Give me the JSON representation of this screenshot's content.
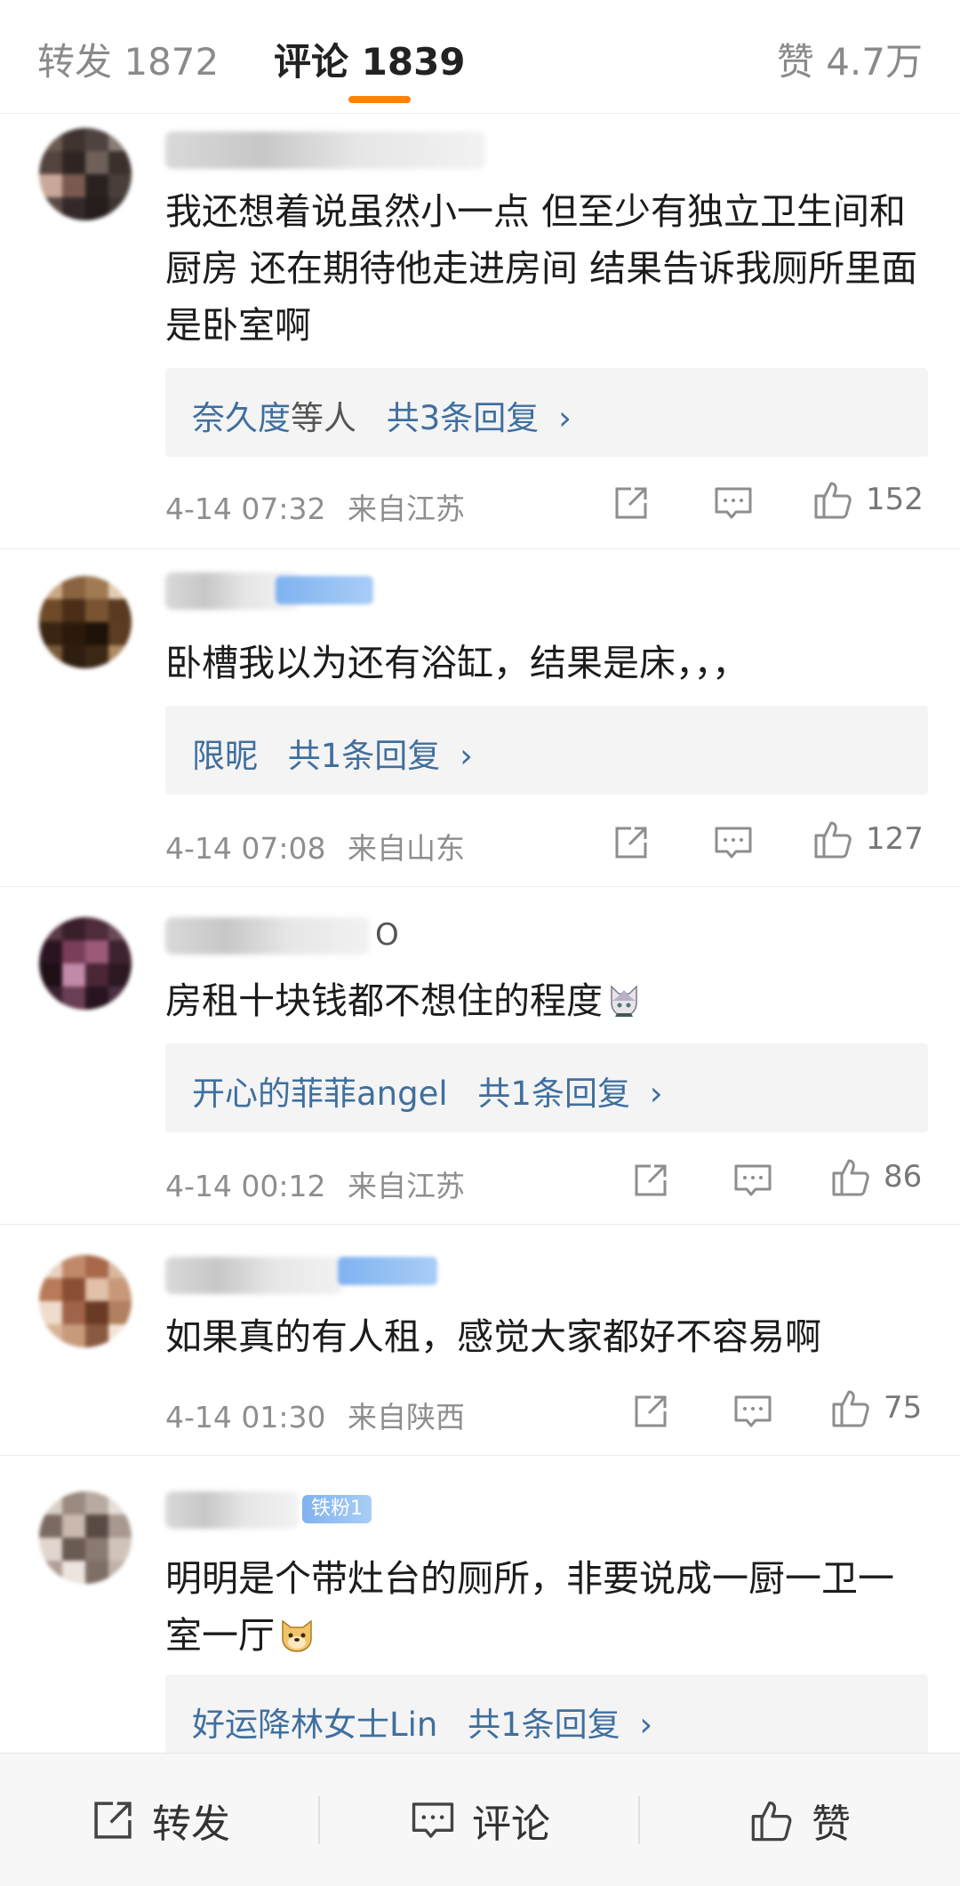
{
  "tabs": {
    "repost": "转发 1872",
    "comments": "评论 1839",
    "likes": "赞 4.7万"
  },
  "comments": [
    {
      "text": "我还想着说虽然小一点 但至少有独立卫生间和厨房 还在期待他走进房间 结果告诉我厕所里面是卧室啊",
      "reply_user": "奈久度",
      "reply_others": "等人",
      "reply_count": "共3条回复",
      "time": "4-14 07:32",
      "location": "来自江苏",
      "likes": "152"
    },
    {
      "text": "卧槽我以为还有浴缸，结果是床，，，",
      "reply_user": "限昵",
      "reply_count": "共1条回复",
      "time": "4-14 07:08",
      "location": "来自山东",
      "likes": "127"
    },
    {
      "name_suffix": "O",
      "text": "房租十块钱都不想住的程度",
      "reply_user": "开心的菲菲angel",
      "reply_count": "共1条回复",
      "time": "4-14 00:12",
      "location": "来自江苏",
      "likes": "86"
    },
    {
      "text": "如果真的有人租，感觉大家都好不容易啊",
      "time": "4-14 01:30",
      "location": "来自陕西",
      "likes": "75"
    },
    {
      "badge": "铁粉1",
      "text": "明明是个带灶台的厕所，非要说成一厨一卫一室一厅",
      "reply_user": "好运降林女士Lin",
      "reply_count": "共1条回复"
    }
  ],
  "chevron": "›",
  "bottom_bar": {
    "repost": "转发",
    "comment": "评论",
    "like": "赞"
  },
  "icons": {
    "share": "share-icon",
    "comment": "comment-icon",
    "like": "thumbs-up-icon",
    "emoji_cat": "cat-emoji-icon",
    "emoji_doge": "doge-emoji-icon"
  },
  "colors": {
    "accent": "#ff8200",
    "link": "#3f6f9e",
    "meta": "#8e8e8e"
  }
}
